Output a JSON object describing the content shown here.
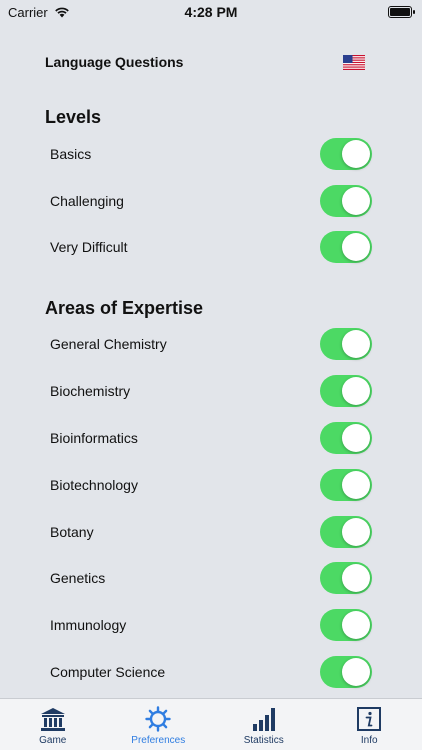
{
  "status": {
    "carrier": "Carrier",
    "time": "4:28 PM"
  },
  "language": {
    "label": "Language Questions",
    "flag": "us-flag-icon"
  },
  "levels": {
    "title": "Levels",
    "items": [
      {
        "label": "Basics",
        "on": true
      },
      {
        "label": "Challenging",
        "on": true
      },
      {
        "label": "Very Difficult",
        "on": true
      }
    ]
  },
  "areas": {
    "title": "Areas of Expertise",
    "items": [
      {
        "label": "General Chemistry",
        "on": true
      },
      {
        "label": "Biochemistry",
        "on": true
      },
      {
        "label": "Bioinformatics",
        "on": true
      },
      {
        "label": "Biotechnology",
        "on": true
      },
      {
        "label": "Botany",
        "on": true
      },
      {
        "label": "Genetics",
        "on": true
      },
      {
        "label": "Immunology",
        "on": true
      },
      {
        "label": "Computer Science",
        "on": true
      }
    ]
  },
  "tabs": [
    {
      "label": "Game",
      "icon": "bank-icon"
    },
    {
      "label": "Preferences",
      "icon": "gear-icon",
      "active": true
    },
    {
      "label": "Statistics",
      "icon": "bar-chart-icon"
    },
    {
      "label": "Info",
      "icon": "info-icon"
    }
  ],
  "colors": {
    "toggle_on": "#4cd964",
    "tab_active": "#2f7de1",
    "tab_inactive": "#1f3b63"
  }
}
